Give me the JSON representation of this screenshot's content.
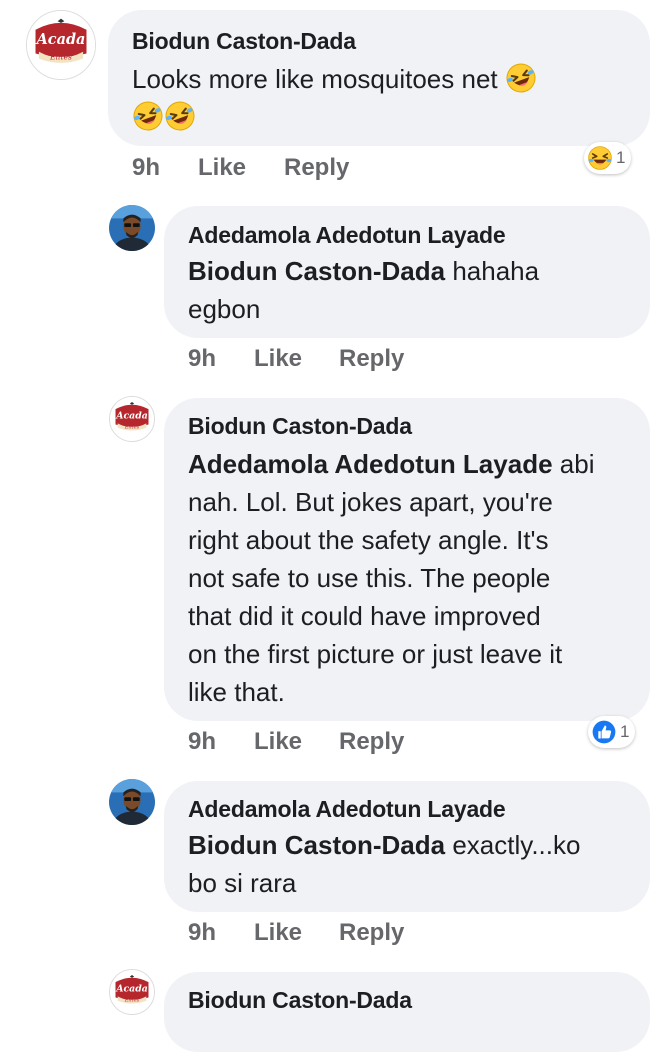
{
  "comments": [
    {
      "author": "Biodun Caston-Dada",
      "mention": "",
      "text": "Looks more like mosquitoes net",
      "time": "9h",
      "like": "Like",
      "reply": "Reply",
      "reaction_count": "1",
      "reaction_icon": "laughing-emoji",
      "avatar": "acada-elites-logo",
      "logo_text_top": "Acada",
      "logo_text_bottom": "Elites"
    },
    {
      "author": "Adedamola Adedotun Layade",
      "mention": "Biodun Caston-Dada",
      "text": "hahaha",
      "text2": "egbon",
      "time": "9h",
      "like": "Like",
      "reply": "Reply",
      "avatar": "user-photo"
    },
    {
      "author": "Biodun Caston-Dada",
      "mention": "Adedamola Adedotun Layade",
      "lines": [
        "abi",
        "nah. Lol. But jokes apart, you're",
        "right about the safety angle. It's",
        "not safe to use this. The people",
        "that did it could have improved",
        "on the first picture or just leave it",
        "like that."
      ],
      "time": "9h",
      "like": "Like",
      "reply": "Reply",
      "reaction_count": "1",
      "reaction_icon": "like-thumb",
      "avatar": "acada-elites-logo",
      "logo_text_top": "Acada",
      "logo_text_bottom": "Elites"
    },
    {
      "author": "Adedamola Adedotun Layade",
      "mention": "Biodun Caston-Dada",
      "text": "exactly...ko",
      "text2": "bo si rara",
      "time": "9h",
      "like": "Like",
      "reply": "Reply",
      "avatar": "user-photo"
    },
    {
      "author": "Biodun Caston-Dada",
      "avatar": "acada-elites-logo",
      "logo_text_top": "Acada",
      "logo_text_bottom": "Elites"
    }
  ],
  "colors": {
    "bubble": "#f0f2f5",
    "meta": "#65676b",
    "like_blue": "#1877f2",
    "logo_red": "#b5272d",
    "emoji_yellow": "#ffcc33"
  }
}
